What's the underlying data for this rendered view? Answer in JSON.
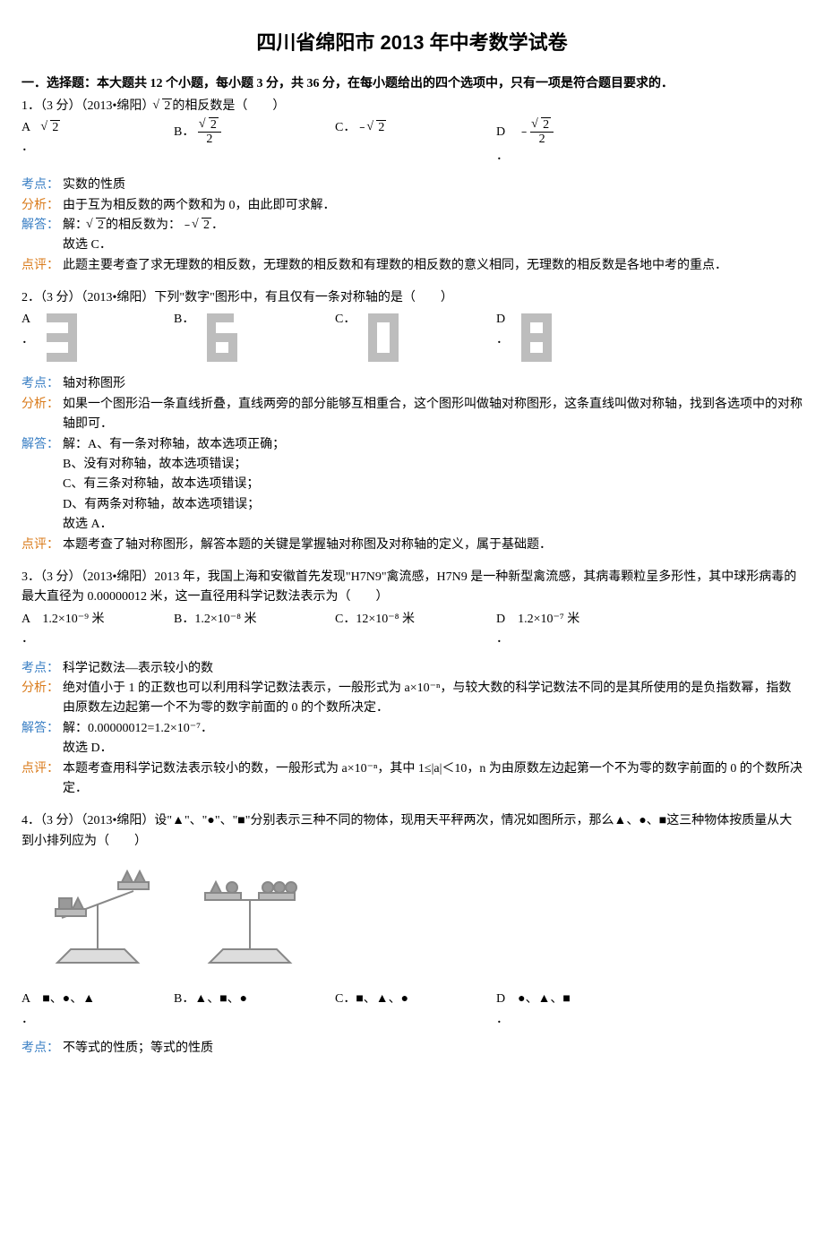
{
  "title": "四川省绵阳市 2013 年中考数学试卷",
  "section_head": "一．选择题：本大题共 12 个小题，每小题 3 分，共 36 分，在每小题给出的四个选项中，只有一项是符合题目要求的．",
  "q1": {
    "stem": "1．（3 分）（2013•绵阳）√2的相反数是（　　）",
    "A_label": "A",
    "B_label": "B．",
    "C_label": "C．",
    "D_label": "D",
    "dot": "．",
    "kaodian_label": "考点：",
    "kaodian": "实数的性质",
    "fenxi_label": "分析：",
    "fenxi": "由于互为相反数的两个数和为 0，由此即可求解．",
    "jieda_label": "解答：",
    "jieda1": "解：√2的相反数为：﹣√2．",
    "jieda2": "故选 C．",
    "dianping_label": "点评：",
    "dianping": "此题主要考查了求无理数的相反数，无理数的相反数和有理数的相反数的意义相同，无理数的相反数是各地中考的重点．",
    "optA": "√2",
    "optC": "﹣√2"
  },
  "q2": {
    "stem": "2．（3 分）（2013•绵阳）下列\"数字\"图形中，有且仅有一条对称轴的是（　　）",
    "A_label": "A",
    "B_label": "B．",
    "C_label": "C．",
    "D_label": "D",
    "dot": "．",
    "kaodian_label": "考点：",
    "kaodian": "轴对称图形",
    "fenxi_label": "分析：",
    "fenxi": "如果一个图形沿一条直线折叠，直线两旁的部分能够互相重合，这个图形叫做轴对称图形，这条直线叫做对称轴，找到各选项中的对称轴即可．",
    "jieda_label": "解答：",
    "jieda1": "解：A、有一条对称轴，故本选项正确；",
    "jieda2": "B、没有对称轴，故本选项错误；",
    "jieda3": "C、有三条对称轴，故本选项错误；",
    "jieda4": "D、有两条对称轴，故本选项错误；",
    "jieda5": "故选 A．",
    "dianping_label": "点评：",
    "dianping": "本题考查了轴对称图形，解答本题的关键是掌握轴对称图及对称轴的定义，属于基础题．"
  },
  "q3": {
    "stem": "3．（3 分）（2013•绵阳）2013 年，我国上海和安徽首先发现\"H7N9\"禽流感，H7N9 是一种新型禽流感，其病毒颗粒呈多形性，其中球形病毒的最大直径为 0.00000012 米，这一直径用科学记数法表示为（　　）",
    "A_label": "A",
    "B_label": "B．",
    "C_label": "C．",
    "D_label": "D",
    "dot": "．",
    "optA": "1.2×10⁻⁹ 米",
    "optB": "1.2×10⁻⁸ 米",
    "optC": "12×10⁻⁸ 米",
    "optD": "1.2×10⁻⁷ 米",
    "kaodian_label": "考点：",
    "kaodian": "科学记数法—表示较小的数",
    "fenxi_label": "分析：",
    "fenxi": "绝对值小于 1 的正数也可以利用科学记数法表示，一般形式为 a×10⁻ⁿ，与较大数的科学记数法不同的是其所使用的是负指数幂，指数由原数左边起第一个不为零的数字前面的 0 的个数所决定．",
    "jieda_label": "解答：",
    "jieda1": "解：0.00000012=1.2×10⁻⁷．",
    "jieda2": "故选 D．",
    "dianping_label": "点评：",
    "dianping": "本题考查用科学记数法表示较小的数，一般形式为 a×10⁻ⁿ，其中 1≤|a|＜10，n 为由原数左边起第一个不为零的数字前面的 0 的个数所决定．"
  },
  "q4": {
    "stem": "4．（3 分）（2013•绵阳）设\"▲\"、\"●\"、\"■\"分别表示三种不同的物体，现用天平秤两次，情况如图所示，那么▲、●、■这三种物体按质量从大到小排列应为（　　）",
    "A_label": "A",
    "B_label": "B．",
    "C_label": "C．",
    "D_label": "D",
    "dot": "．",
    "optA": "■、●、▲",
    "optB": "▲、■、●",
    "optC": "■、▲、●",
    "optD": "●、▲、■",
    "kaodian_label": "考点：",
    "kaodian": "不等式的性质；等式的性质"
  }
}
